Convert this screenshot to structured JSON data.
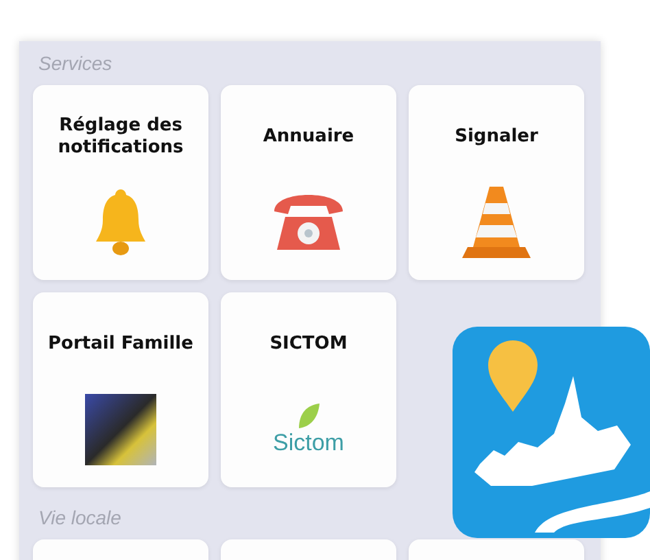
{
  "sections": [
    {
      "title": "Services",
      "tiles": [
        {
          "label": "Réglage des notifications",
          "kind": "bell"
        },
        {
          "label": "Annuaire",
          "kind": "phone"
        },
        {
          "label": "Signaler",
          "kind": "cone"
        },
        {
          "label": "Portail Famille",
          "kind": "photo"
        },
        {
          "label": "SICTOM",
          "kind": "logo",
          "logo_text": "Sictom"
        }
      ]
    },
    {
      "title": "Vie locale",
      "tiles": [
        {
          "kind": "blank"
        },
        {
          "kind": "blank"
        },
        {
          "kind": "blank"
        }
      ]
    }
  ],
  "app_icon": {
    "kind": "pin-village"
  }
}
